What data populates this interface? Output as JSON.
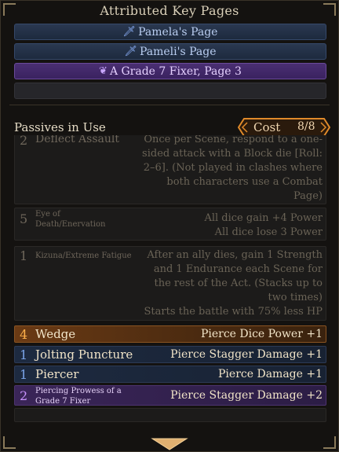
{
  "key_pages": {
    "title": "Attributed Key Pages",
    "items": [
      {
        "label": "Pamela's Page",
        "style": "blue",
        "icon": "blade-icon"
      },
      {
        "label": "Pameli's Page",
        "style": "blue",
        "icon": "blade-icon"
      },
      {
        "label": "A Grade 7 Fixer, Page 3",
        "style": "purple",
        "icon": "fixer-icon"
      }
    ]
  },
  "passives": {
    "title": "Passives in Use",
    "cost_label": "Cost",
    "cost_value": "8/8",
    "rows": [
      {
        "cost": "2",
        "name": "Deflect Assault",
        "desc1": "Once per Scene, respond to a one-",
        "desc2": "sided attack with a Block die [Roll:",
        "desc3": "2–6]. (Not played in clashes where",
        "desc4": "both characters use a Combat",
        "desc5": "Page)"
      },
      {
        "cost": "5",
        "name1": "Eye of",
        "name2": "Death/Enervation",
        "desc1": "All dice gain +4 Power",
        "desc2": "All dice lose 3 Power"
      },
      {
        "cost": "1",
        "name": "Kizuna/Extreme Fatigue",
        "desc1": "After an ally dies, gain 1 Strength",
        "desc2": "and 1 Endurance each Scene for",
        "desc3": "the rest of the Act. (Stacks up to",
        "desc4": "two times)",
        "desc5": "Starts the battle with 75% less HP"
      },
      {
        "cost": "4",
        "name": "Wedge",
        "desc": "Pierce Dice Power +1"
      },
      {
        "cost": "1",
        "name": "Jolting Puncture",
        "desc": "Pierce Stagger Damage +1"
      },
      {
        "cost": "1",
        "name": "Piercer",
        "desc": "Pierce Damage +1"
      },
      {
        "cost": "2",
        "name1": "Piercing Prowess of a",
        "name2": "Grade 7 Fixer",
        "desc": "Pierce Stagger Damage +2"
      }
    ]
  },
  "colors": {
    "accent_orange": "#ffb04a",
    "blue_page": "#2a3850",
    "purple_page": "#4a2f72"
  }
}
